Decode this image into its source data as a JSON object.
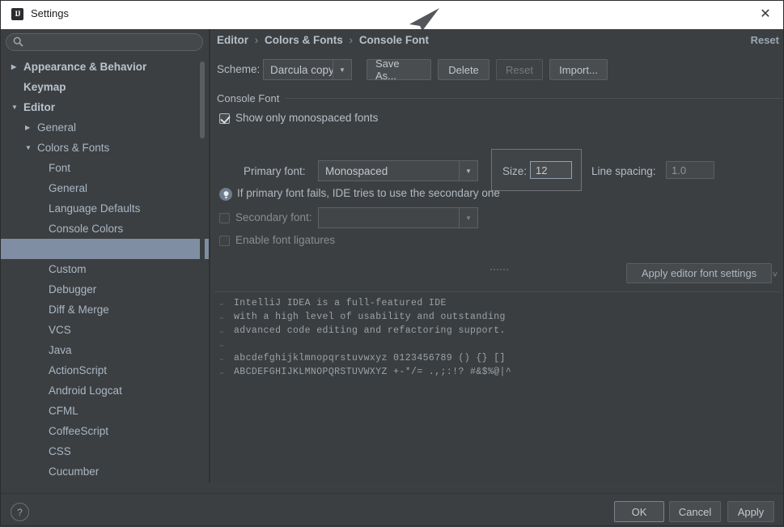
{
  "window": {
    "title": "Settings",
    "app_icon": "intellij-idea-icon",
    "close_label": "✕"
  },
  "sidebar": {
    "search": {
      "placeholder": "",
      "value": "",
      "icon": "search-icon"
    },
    "items": [
      {
        "label": "Appearance & Behavior",
        "level": 0,
        "arrow": "▶",
        "bold": true,
        "selected": false
      },
      {
        "label": "Keymap",
        "level": 0,
        "arrow": "",
        "bold": true,
        "selected": false
      },
      {
        "label": "Editor",
        "level": 0,
        "arrow": "▼",
        "bold": true,
        "selected": false
      },
      {
        "label": "General",
        "level": 1,
        "arrow": "▶",
        "bold": false,
        "selected": false
      },
      {
        "label": "Colors & Fonts",
        "level": 1,
        "arrow": "▼",
        "bold": false,
        "selected": false
      },
      {
        "label": "Font",
        "level": 2,
        "arrow": "",
        "bold": false,
        "selected": false
      },
      {
        "label": "General",
        "level": 2,
        "arrow": "",
        "bold": false,
        "selected": false
      },
      {
        "label": "Language Defaults",
        "level": 2,
        "arrow": "",
        "bold": false,
        "selected": false
      },
      {
        "label": "Console Colors",
        "level": 2,
        "arrow": "",
        "bold": false,
        "selected": false
      },
      {
        "label": "",
        "level": 2,
        "arrow": "",
        "bold": false,
        "selected": true
      },
      {
        "label": "Custom",
        "level": 2,
        "arrow": "",
        "bold": false,
        "selected": false
      },
      {
        "label": "Debugger",
        "level": 2,
        "arrow": "",
        "bold": false,
        "selected": false
      },
      {
        "label": "Diff & Merge",
        "level": 2,
        "arrow": "",
        "bold": false,
        "selected": false
      },
      {
        "label": "VCS",
        "level": 2,
        "arrow": "",
        "bold": false,
        "selected": false
      },
      {
        "label": "Java",
        "level": 2,
        "arrow": "",
        "bold": false,
        "selected": false
      },
      {
        "label": "ActionScript",
        "level": 2,
        "arrow": "",
        "bold": false,
        "selected": false
      },
      {
        "label": "Android Logcat",
        "level": 2,
        "arrow": "",
        "bold": false,
        "selected": false
      },
      {
        "label": "CFML",
        "level": 2,
        "arrow": "",
        "bold": false,
        "selected": false
      },
      {
        "label": "CoffeeScript",
        "level": 2,
        "arrow": "",
        "bold": false,
        "selected": false
      },
      {
        "label": "CSS",
        "level": 2,
        "arrow": "",
        "bold": false,
        "selected": false
      },
      {
        "label": "Cucumber",
        "level": 2,
        "arrow": "",
        "bold": false,
        "selected": false
      }
    ]
  },
  "panel": {
    "breadcrumb": {
      "part1": "Editor",
      "part2": "Colors & Fonts",
      "part3": "Console Font",
      "separator": "›"
    },
    "reset_link": "Reset",
    "scheme": {
      "label": "Scheme:",
      "value": "Darcula copy",
      "arrow": "▼",
      "save_as": "Save As...",
      "delete": "Delete",
      "reset": "Reset",
      "import": "Import..."
    },
    "group_title": "Console Font",
    "show_monospaced": {
      "label": "Show only monospaced fonts",
      "checked": true
    },
    "primary_font": {
      "label": "Primary font:",
      "value": "Monospaced",
      "arrow": "▼"
    },
    "size": {
      "label": "Size:",
      "value": "12"
    },
    "line_spacing": {
      "label": "Line spacing:",
      "value": "1.0"
    },
    "hint": {
      "text": "If primary font fails, IDE tries to use the secondary one",
      "icon": "info-bulb-icon"
    },
    "secondary_font": {
      "label": "Secondary font:",
      "value": "",
      "arrow": "▼",
      "checked": false
    },
    "ligatures": {
      "label": "Enable font ligatures",
      "checked": false
    },
    "apply_editor_font": "Apply editor font settings",
    "collapse_chevron": "˅",
    "preview": {
      "lines": [
        "IntelliJ IDEA is a full-featured IDE",
        "with a high level of usability and outstanding",
        "advanced code editing and refactoring support.",
        "",
        "abcdefghijklmnopqrstuvwxyz 0123456789 () {} []",
        "ABCDEFGHIJKLMNOPQRSTUVWXYZ +-*/= .,;:!? #&$%@|^"
      ]
    }
  },
  "footer": {
    "help": "?",
    "ok": "OK",
    "cancel": "Cancel",
    "apply": "Apply"
  },
  "colors": {
    "window_bg": "#3c3f41",
    "titlebar_bg": "#ffffff",
    "text": "#b7bfc7",
    "selection": "#7f8ea3",
    "field_bg": "#45484a",
    "focus_border": "#8ea0b4",
    "preview_text": "#9aa2a8"
  }
}
